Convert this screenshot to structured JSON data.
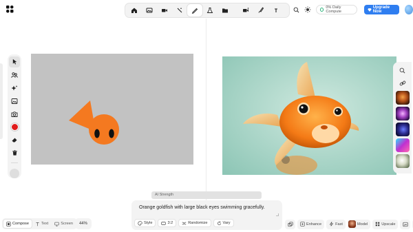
{
  "app": {
    "logo_icon": "krea-logo-icon"
  },
  "top_toolbar": {
    "tools": [
      {
        "name": "home-icon",
        "active": false
      },
      {
        "name": "image-icon",
        "active": false
      },
      {
        "name": "video-icon",
        "active": false
      },
      {
        "name": "enhance-wand-icon",
        "active": false
      },
      {
        "name": "realtime-pen-icon",
        "active": true
      },
      {
        "name": "train-flask-icon",
        "active": false
      },
      {
        "name": "folder-icon",
        "active": false
      },
      {
        "name": "video-lipsync-icon",
        "active": false
      },
      {
        "name": "edit-brush-icon",
        "active": false
      },
      {
        "name": "text-icon",
        "active": false
      }
    ]
  },
  "top_right": {
    "compute_label": "0% Daily Compute",
    "upgrade_label": "Upgrade Now",
    "compute_color": "#2ab37a",
    "upgrade_color": "#2f7ef0"
  },
  "left_tools": {
    "items": [
      "select-cursor-icon",
      "people-icon",
      "sparkle-icon",
      "image-upload-icon",
      "camera-icon",
      "color-swatch",
      "eraser-icon",
      "trash-icon"
    ],
    "brush_color": "#e01c1c"
  },
  "canvas": {
    "background": "#c2c2c2",
    "fish_color": "#f47920"
  },
  "right_rail": {
    "buttons": [
      "search-icon",
      "link-icon"
    ],
    "thumbnails": 5
  },
  "prompt": {
    "ai_strength_label": "AI Strength",
    "text": "Orange goldfish with large black eyes swimming gracefully.",
    "actions": [
      {
        "label": "Style",
        "icon": "palette-icon"
      },
      {
        "label": "3:2",
        "icon": "aspect-ratio-icon"
      },
      {
        "label": "Randomize",
        "icon": "shuffle-icon"
      },
      {
        "label": "Vary",
        "icon": "refresh-icon"
      }
    ]
  },
  "mode_bar": {
    "modes": [
      {
        "label": "Compose",
        "icon": "compose-icon",
        "active": true
      },
      {
        "label": "Text",
        "icon": "text-icon",
        "active": false
      },
      {
        "label": "Screen",
        "icon": "monitor-icon",
        "active": false
      }
    ],
    "zoom": "44%"
  },
  "bottom_right": {
    "enhance_label": "Enhance",
    "fast_label": "Fast",
    "model_label": "Model",
    "upscale_label": "Upscale"
  }
}
